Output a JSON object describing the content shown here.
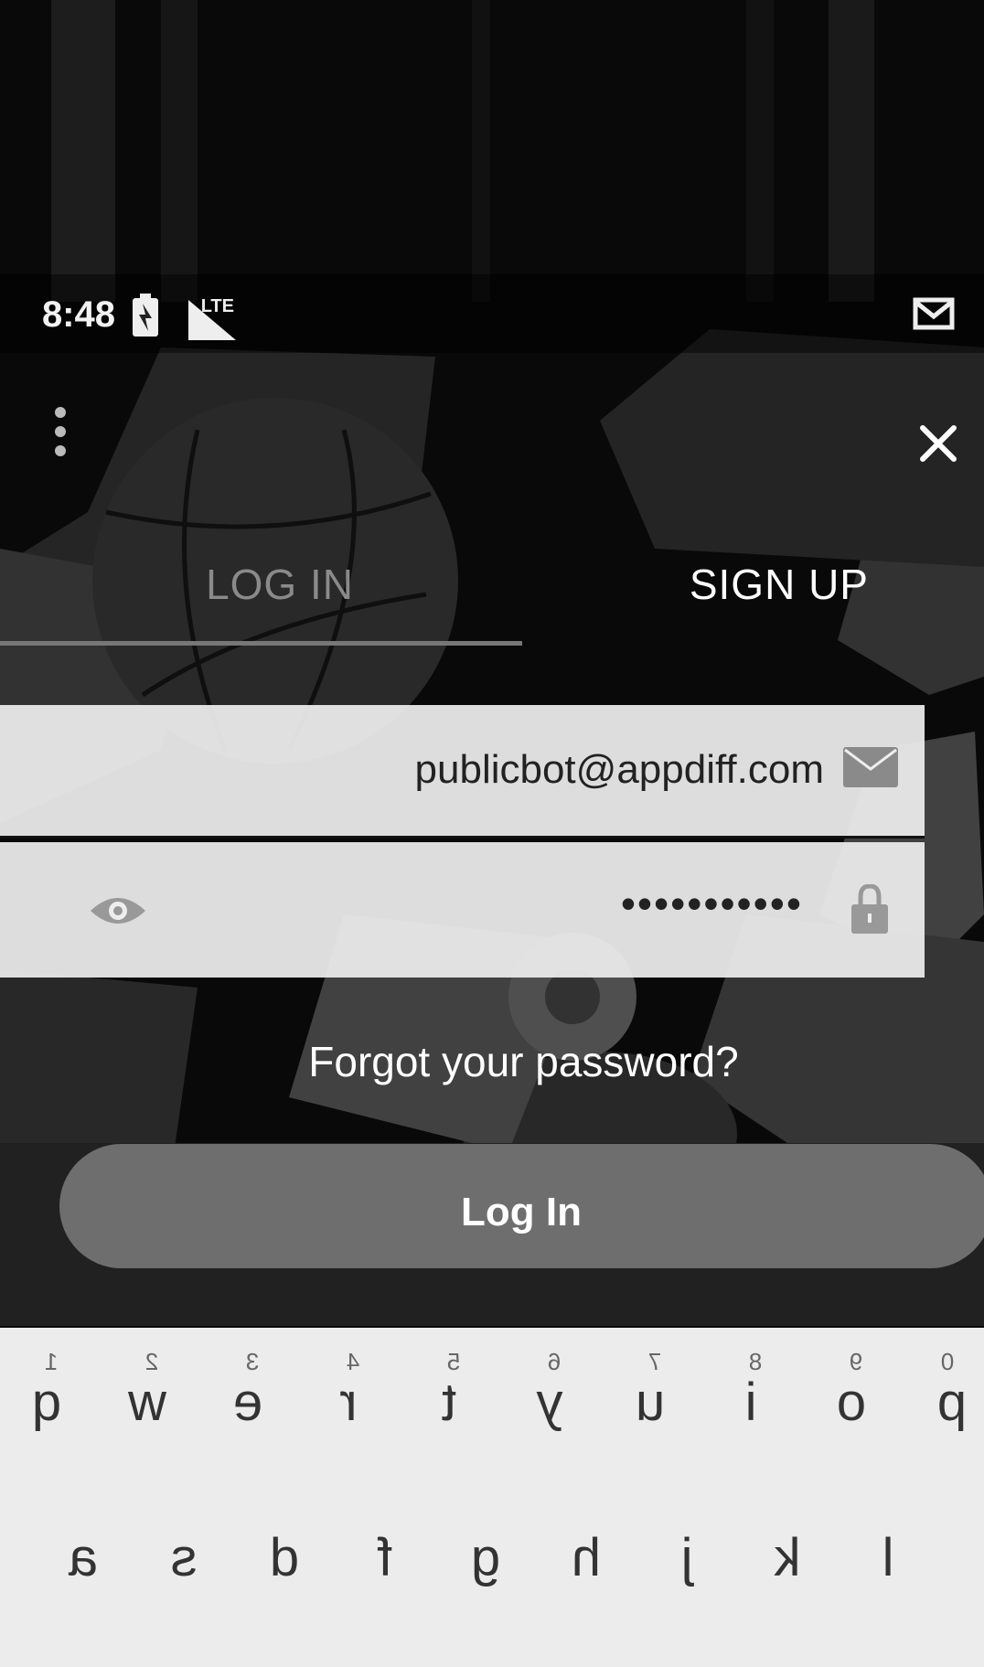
{
  "status_bar": {
    "time": "8:48",
    "network": "LTE"
  },
  "toolbar": {
    "menu_icon": "more-vert-icon",
    "close_icon": "close-icon"
  },
  "tabs": [
    {
      "label": "LOG IN",
      "selected": true
    },
    {
      "label": "SIGN UP",
      "selected": false
    }
  ],
  "form": {
    "email_value": "publicbot@appdiff.com",
    "password_value": "•••••••••••",
    "email_icon": "mail-icon",
    "password_icon": "lock-icon",
    "visibility_icon": "eye-icon"
  },
  "forgot_password": "Forgot your password?",
  "login_button": "Log In",
  "keyboard": {
    "row1": [
      "q",
      "w",
      "e",
      "r",
      "t",
      "y",
      "u",
      "i",
      "o",
      "p"
    ],
    "numbers": [
      "1",
      "2",
      "3",
      "4",
      "5",
      "6",
      "7",
      "8",
      "9",
      "0"
    ],
    "row2": [
      "a",
      "s",
      "d",
      "f",
      "g",
      "h",
      "j",
      "k",
      "l"
    ]
  },
  "colors": {
    "background": "#0a0a0a",
    "field_background": "#eeeeee",
    "button": "#6e6e6e",
    "keyboard_background": "#ececec"
  }
}
